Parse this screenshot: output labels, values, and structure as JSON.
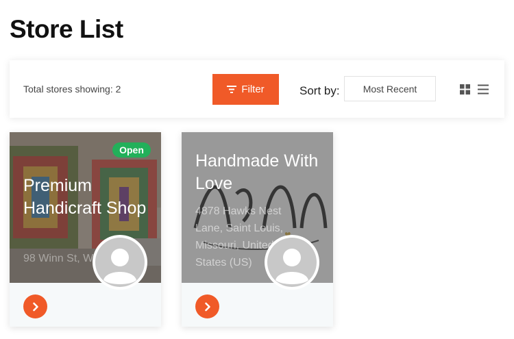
{
  "page": {
    "title": "Store List"
  },
  "toolbar": {
    "total_text": "Total stores showing: 2",
    "filter_label": "Filter",
    "sort_label": "Sort by:",
    "sort_value": "Most Recent"
  },
  "stores": [
    {
      "name": "Premium Handicraft Shop",
      "address": "98 Winn St, Woburn,",
      "status": "Open"
    },
    {
      "name": "Handmade With Love",
      "address": "4878 Hawks Nest Lane, Saint Louis, Missouri, United States (US)"
    }
  ],
  "colors": {
    "accent": "#f05a28",
    "open_badge": "#22b05a",
    "footer_bg": "#f6f9fa"
  },
  "icons": [
    "filter-icon",
    "grid-view-icon",
    "list-view-icon",
    "chevron-right-icon",
    "user-avatar-icon"
  ]
}
